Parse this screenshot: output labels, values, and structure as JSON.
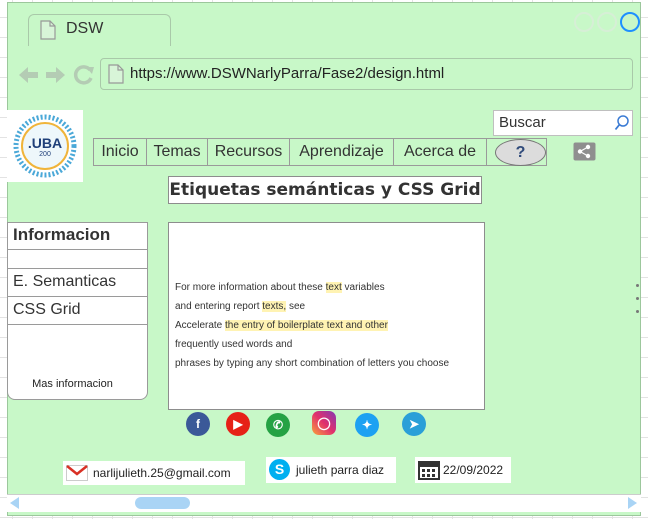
{
  "browser": {
    "tab_title": "DSW",
    "url": "https://www.DSWNarlyParra/Fase2/design.html"
  },
  "logo": {
    "text": ".UBA",
    "subtext": "200"
  },
  "search": {
    "placeholder": "Buscar"
  },
  "nav": {
    "items": [
      "Inicio",
      "Temas",
      "Recursos",
      "Aprendizaje",
      "Acerca de"
    ],
    "help_label": "?"
  },
  "page": {
    "title": "Etiquetas semánticas y CSS Grid"
  },
  "sidebar": {
    "header": "Informacion",
    "items": [
      "",
      "E. Semanticas",
      "CSS Grid"
    ],
    "more_label": "Mas informacion"
  },
  "content": {
    "lines": [
      {
        "before": "For more information about these ",
        "mark": "text",
        "after": " variables"
      },
      {
        "before": "and entering report ",
        "mark": "texts,",
        "after": " see"
      },
      {
        "before": "Accelerate ",
        "mark": "the entry of boilerplate text and other",
        "after": ""
      },
      {
        "before": "frequently used words and",
        "mark": "",
        "after": ""
      },
      {
        "before": "phrases by typing any short combination of letters you choose",
        "mark": "",
        "after": ""
      }
    ]
  },
  "social": [
    "facebook",
    "youtube",
    "whatsapp",
    "instagram",
    "twitter",
    "telegram"
  ],
  "footer": {
    "email": "narlijulieth.25@gmail.com",
    "skype_name": "julieth parra diaz",
    "date": "22/09/2022"
  },
  "colors": {
    "background": "#c8f8c8",
    "window_dot_outline": "#1e90ff",
    "scroll_thumb": "#a9d4f5"
  }
}
